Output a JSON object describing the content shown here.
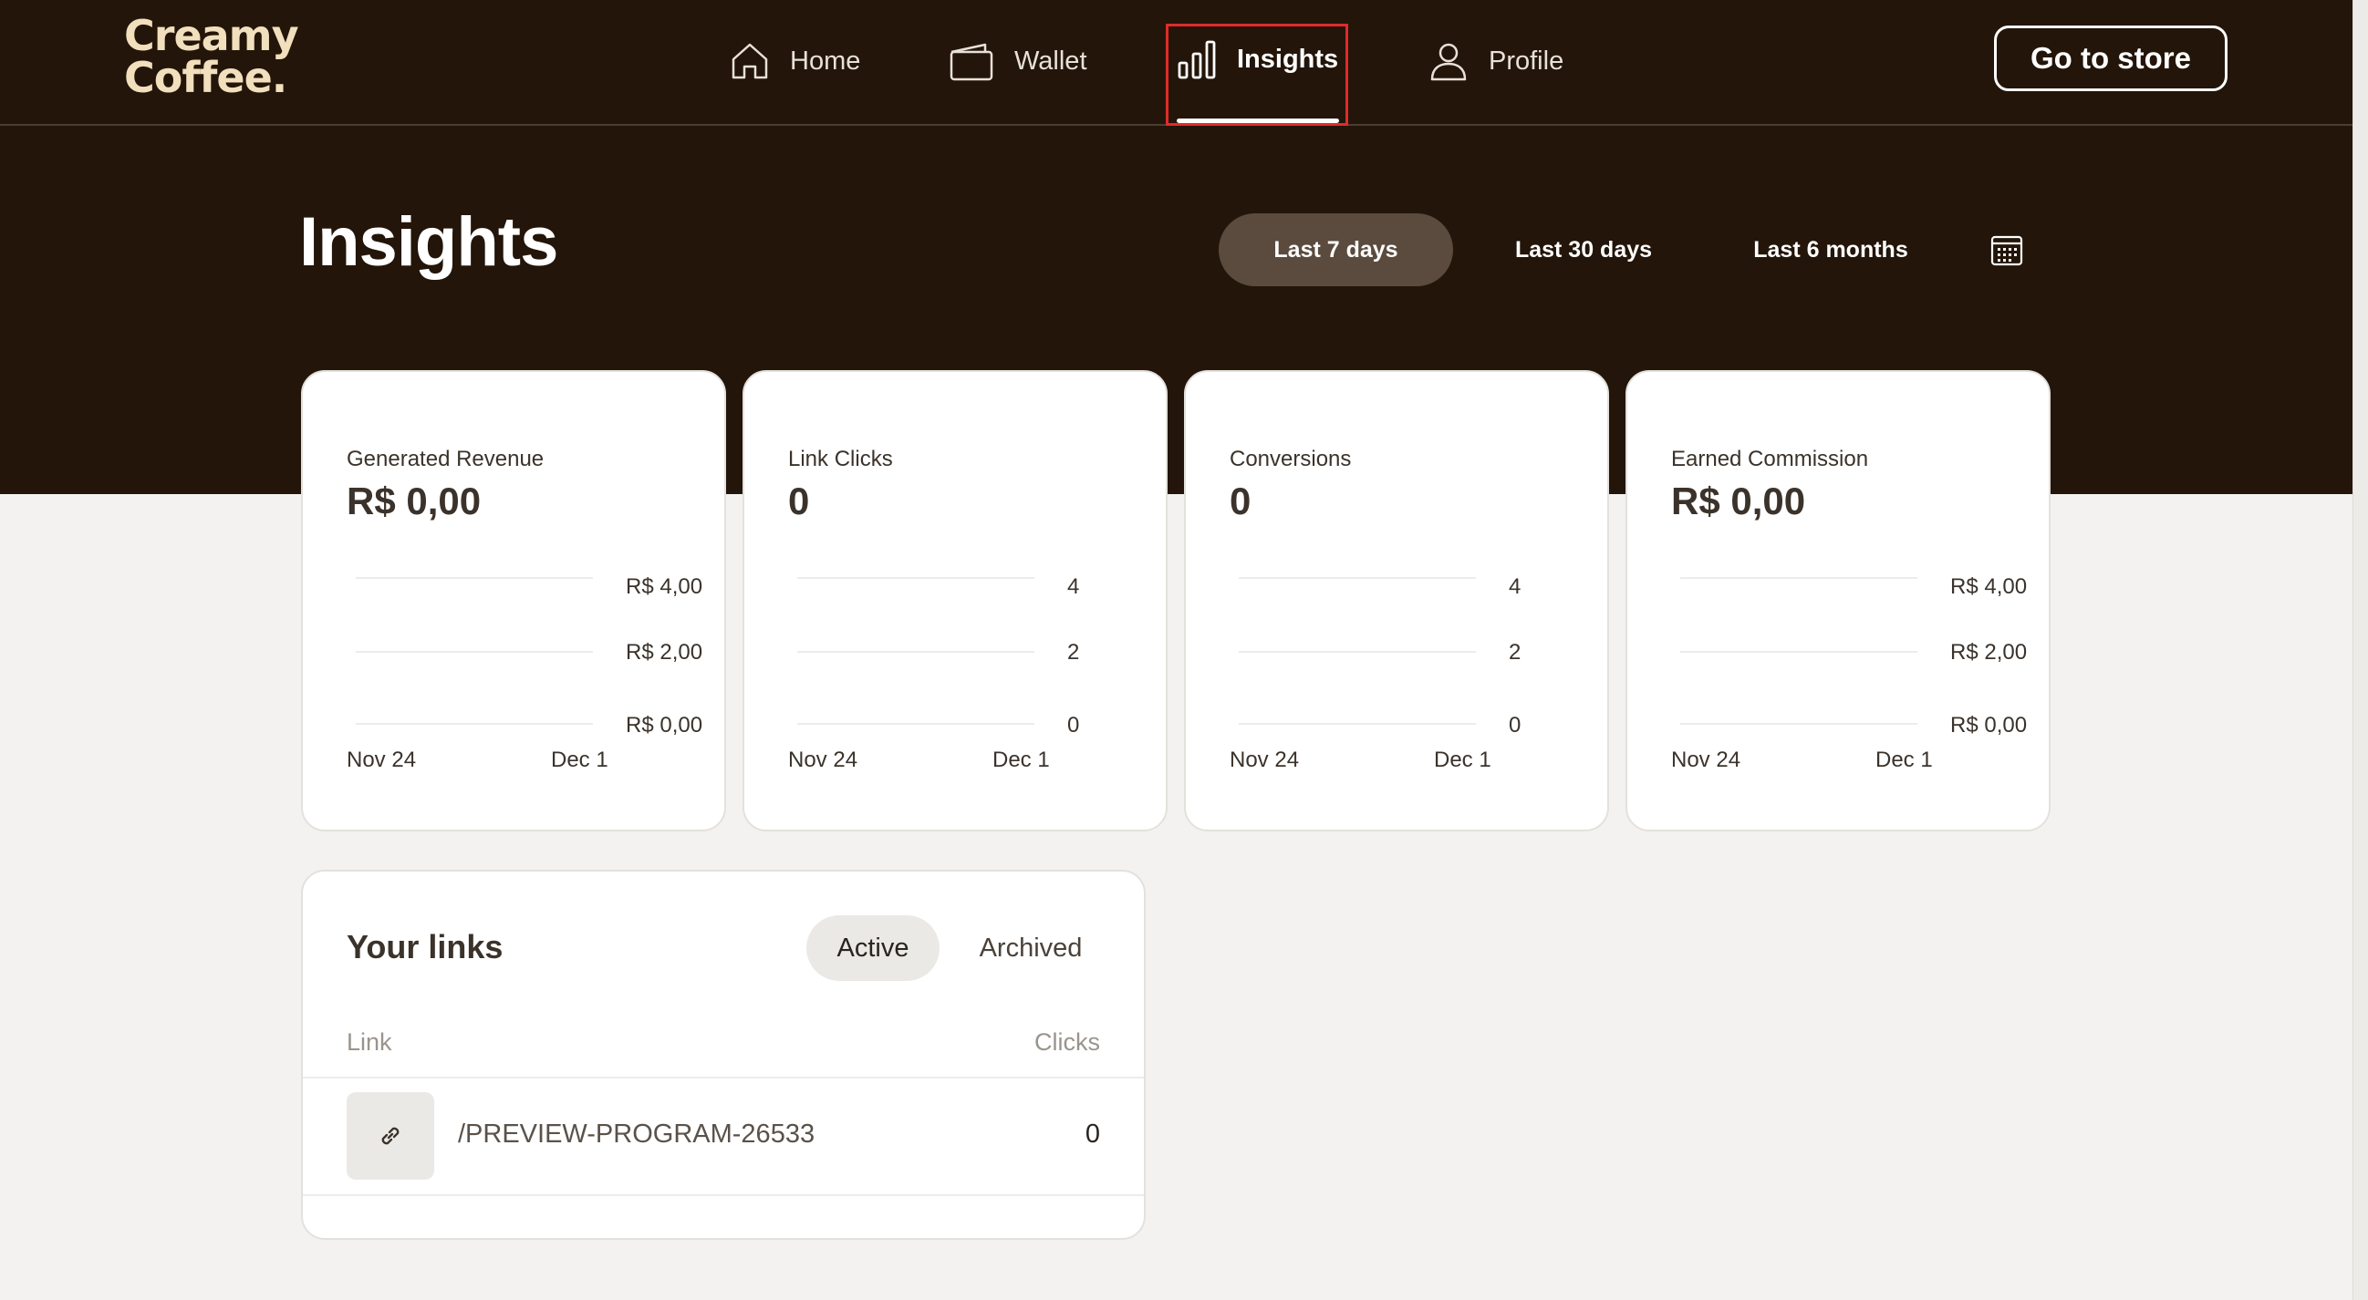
{
  "brand": {
    "line1": "Creamy",
    "line2": "Coffee."
  },
  "nav": {
    "home": "Home",
    "wallet": "Wallet",
    "insights": "Insights",
    "profile": "Profile",
    "store_button": "Go to store",
    "active": "Insights"
  },
  "page": {
    "title": "Insights"
  },
  "ranges": {
    "last7": "Last 7 days",
    "last30": "Last 30 days",
    "last6m": "Last 6 months",
    "selected": "Last 7 days"
  },
  "metrics": [
    {
      "label": "Generated Revenue",
      "value": "R$ 0,00",
      "ticks": [
        "R$ 4,00",
        "R$ 2,00",
        "R$ 0,00"
      ],
      "x_start": "Nov 24",
      "x_end": "Dec 1"
    },
    {
      "label": "Link Clicks",
      "value": "0",
      "ticks": [
        "4",
        "2",
        "0"
      ],
      "x_start": "Nov 24",
      "x_end": "Dec 1"
    },
    {
      "label": "Conversions",
      "value": "0",
      "ticks": [
        "4",
        "2",
        "0"
      ],
      "x_start": "Nov 24",
      "x_end": "Dec 1"
    },
    {
      "label": "Earned Commission",
      "value": "R$ 0,00",
      "ticks": [
        "R$ 4,00",
        "R$ 2,00",
        "R$ 0,00"
      ],
      "x_start": "Nov 24",
      "x_end": "Dec 1"
    }
  ],
  "links": {
    "title": "Your links",
    "tabs": {
      "active": "Active",
      "archived": "Archived"
    },
    "columns": {
      "link": "Link",
      "clicks": "Clicks"
    },
    "rows": [
      {
        "path": "/PREVIEW-PROGRAM-26533",
        "clicks": "0"
      }
    ]
  },
  "colors": {
    "hero_bg": "#231509",
    "logo": "#f1dfbd",
    "selected_pill": "#5a4b3e",
    "page_bg": "#f3f2f0"
  }
}
